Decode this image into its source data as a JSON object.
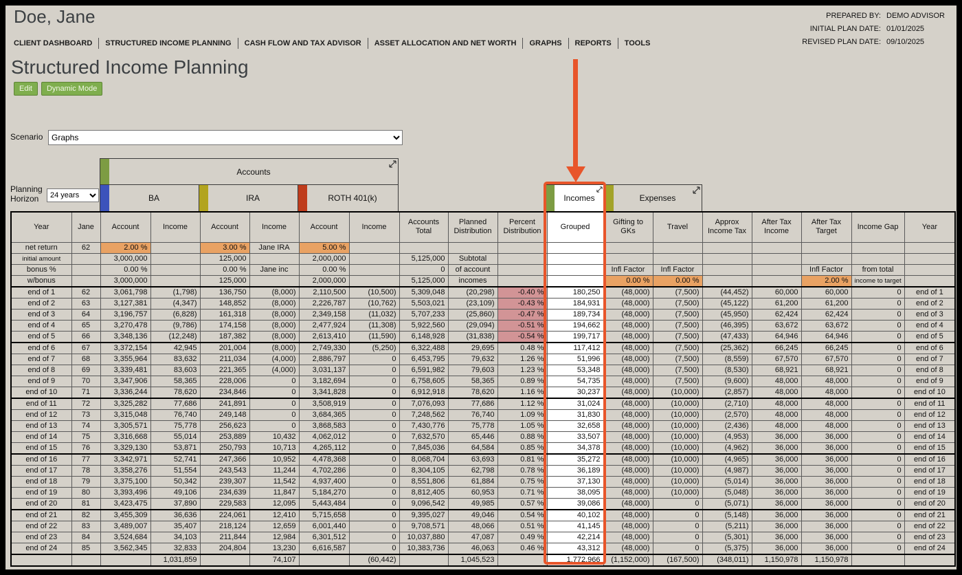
{
  "header": {
    "client_name": "Doe, Jane"
  },
  "plan_info": {
    "prepared_by_label": "PREPARED BY:",
    "prepared_by": "DEMO ADVISOR",
    "initial_plan_label": "INITIAL PLAN DATE:",
    "initial_plan_date": "01/01/2025",
    "revised_plan_label": "REVISED PLAN DATE:",
    "revised_plan_date": "09/10/2025"
  },
  "nav": {
    "items": [
      "CLIENT DASHBOARD",
      "STRUCTURED INCOME PLANNING",
      "CASH FLOW AND TAX ADVISOR",
      "ASSET ALLOCATION AND NET WORTH",
      "GRAPHS",
      "REPORTS",
      "TOOLS"
    ]
  },
  "page": {
    "title": "Structured Income Planning",
    "buttons": [
      "Edit",
      "Dynamic Mode"
    ]
  },
  "scenario": {
    "label": "Scenario",
    "value": "Graphs"
  },
  "planning_horizon": {
    "label": "Planning Horizon",
    "value": "24 years"
  },
  "groups": {
    "accounts": "Accounts",
    "ba": "BA",
    "ira": "IRA",
    "roth": "ROTH 401(k)",
    "incomes": "Incomes",
    "expenses": "Expenses"
  },
  "icons": {
    "expand": "diagonal-resize-arrows"
  },
  "colors": {
    "accent_annotation": "#e8552a",
    "rate_highlight": "#e9a263",
    "negative_pct": "#d29496",
    "button_green": "#7fae4e",
    "chip_green": "#7d9c43",
    "chip_blue": "#3c53bb",
    "chip_yellow": "#b2a41f",
    "chip_red": "#bf3c1c",
    "chip_olive": "#a3a329",
    "background": "#d5d1c9"
  },
  "table": {
    "columns": [
      "Year",
      "Jane",
      "Account",
      "Income",
      "Account",
      "Income",
      "Account",
      "Income",
      "Accounts Total",
      "Planned Distribution",
      "Percent Distribution",
      "Grouped",
      "Gifting to GKs",
      "Travel",
      "Approx Income Tax",
      "After Tax Income",
      "After Tax Target",
      "Income Gap",
      "Year"
    ],
    "pre_rows": [
      [
        "net return",
        "62",
        {
          "t": "2.00 %",
          "hl": true
        },
        "",
        {
          "t": "3.00 %",
          "hl": true
        },
        "Jane IRA",
        {
          "t": "5.00 %",
          "hl": true
        },
        "",
        "",
        "",
        "",
        "",
        "",
        "",
        "",
        "",
        "",
        "",
        ""
      ],
      [
        "initial amount",
        "",
        "3,000,000",
        "",
        "125,000",
        "",
        "2,000,000",
        "",
        "5,125,000",
        "Subtotal",
        "",
        "",
        "",
        "",
        "",
        "",
        "",
        "",
        ""
      ],
      [
        "bonus %",
        "",
        "0.00 %",
        "",
        "0.00 %",
        "Jane inc",
        "0.00 %",
        "",
        "0",
        "of account",
        "",
        "",
        "Infl Factor",
        "Infl Factor",
        "",
        "",
        "Infl Factor",
        "from total",
        ""
      ],
      [
        "w/bonus",
        "",
        "3,000,000",
        "",
        "125,000",
        "",
        "2,000,000",
        "",
        "5,125,000",
        "incomes",
        "",
        "",
        {
          "t": "0.00 %",
          "hl": true
        },
        {
          "t": "0.00 %",
          "hl": true
        },
        "",
        "",
        {
          "t": "2.00 %",
          "hl": true
        },
        "income to target",
        ""
      ]
    ],
    "rows": [
      [
        "end of 1",
        "62",
        "3,061,798",
        "(1,798)",
        "136,750",
        "(8,000)",
        "2,110,500",
        "(10,500)",
        "5,309,048",
        "(20,298)",
        "-0.40 %",
        "180,250",
        "(48,000)",
        "(7,500)",
        "(44,452)",
        "60,000",
        "60,000",
        "0",
        "end of 1"
      ],
      [
        "end of 2",
        "63",
        "3,127,381",
        "(4,347)",
        "148,852",
        "(8,000)",
        "2,226,787",
        "(10,762)",
        "5,503,021",
        "(23,109)",
        "-0.43 %",
        "184,931",
        "(48,000)",
        "(7,500)",
        "(45,122)",
        "61,200",
        "61,200",
        "0",
        "end of 2"
      ],
      [
        "end of 3",
        "64",
        "3,196,757",
        "(6,828)",
        "161,318",
        "(8,000)",
        "2,349,158",
        "(11,032)",
        "5,707,233",
        "(25,860)",
        "-0.47 %",
        "189,734",
        "(48,000)",
        "(7,500)",
        "(45,950)",
        "62,424",
        "62,424",
        "0",
        "end of 3"
      ],
      [
        "end of 4",
        "65",
        "3,270,478",
        "(9,786)",
        "174,158",
        "(8,000)",
        "2,477,924",
        "(11,308)",
        "5,922,560",
        "(29,094)",
        "-0.51 %",
        "194,662",
        "(48,000)",
        "(7,500)",
        "(46,395)",
        "63,672",
        "63,672",
        "0",
        "end of 4"
      ],
      [
        "end of 5",
        "66",
        "3,348,136",
        "(12,248)",
        "187,382",
        "(8,000)",
        "2,613,410",
        "(11,590)",
        "6,148,928",
        "(31,838)",
        "-0.54 %",
        "199,717",
        "(48,000)",
        "(7,500)",
        "(47,433)",
        "64,946",
        "64,946",
        "0",
        "end of 5"
      ],
      [
        "end of 6",
        "67",
        "3,372,154",
        "42,945",
        "201,004",
        "(8,000)",
        "2,749,330",
        "(5,250)",
        "6,322,488",
        "29,695",
        "0.48 %",
        "117,412",
        "(48,000)",
        "(7,500)",
        "(25,362)",
        "66,245",
        "66,245",
        "0",
        "end of 6"
      ],
      [
        "end of 7",
        "68",
        "3,355,964",
        "83,632",
        "211,034",
        "(4,000)",
        "2,886,797",
        "0",
        "6,453,795",
        "79,632",
        "1.26 %",
        "51,996",
        "(48,000)",
        "(7,500)",
        "(8,559)",
        "67,570",
        "67,570",
        "0",
        "end of 7"
      ],
      [
        "end of 8",
        "69",
        "3,339,481",
        "83,603",
        "221,365",
        "(4,000)",
        "3,031,137",
        "0",
        "6,591,982",
        "79,603",
        "1.23 %",
        "53,348",
        "(48,000)",
        "(7,500)",
        "(8,530)",
        "68,921",
        "68,921",
        "0",
        "end of 8"
      ],
      [
        "end of 9",
        "70",
        "3,347,906",
        "58,365",
        "228,006",
        "0",
        "3,182,694",
        "0",
        "6,758,605",
        "58,365",
        "0.89 %",
        "54,735",
        "(48,000)",
        "(7,500)",
        "(9,600)",
        "48,000",
        "48,000",
        "0",
        "end of 9"
      ],
      [
        "end of 10",
        "71",
        "3,336,244",
        "78,620",
        "234,846",
        "0",
        "3,341,828",
        "0",
        "6,912,918",
        "78,620",
        "1.16 %",
        "30,237",
        "(48,000)",
        "(10,000)",
        "(2,857)",
        "48,000",
        "48,000",
        "0",
        "end of 10"
      ],
      [
        "end of 11",
        "72",
        "3,325,282",
        "77,686",
        "241,891",
        "0",
        "3,508,919",
        "0",
        "7,076,093",
        "77,686",
        "1.12 %",
        "31,024",
        "(48,000)",
        "(10,000)",
        "(2,710)",
        "48,000",
        "48,000",
        "0",
        "end of 11"
      ],
      [
        "end of 12",
        "73",
        "3,315,048",
        "76,740",
        "249,148",
        "0",
        "3,684,365",
        "0",
        "7,248,562",
        "76,740",
        "1.09 %",
        "31,830",
        "(48,000)",
        "(10,000)",
        "(2,570)",
        "48,000",
        "48,000",
        "0",
        "end of 12"
      ],
      [
        "end of 13",
        "74",
        "3,305,571",
        "75,778",
        "256,623",
        "0",
        "3,868,583",
        "0",
        "7,430,776",
        "75,778",
        "1.05 %",
        "32,658",
        "(48,000)",
        "(10,000)",
        "(2,436)",
        "48,000",
        "48,000",
        "0",
        "end of 13"
      ],
      [
        "end of 14",
        "75",
        "3,316,668",
        "55,014",
        "253,889",
        "10,432",
        "4,062,012",
        "0",
        "7,632,570",
        "65,446",
        "0.88 %",
        "33,507",
        "(48,000)",
        "(10,000)",
        "(4,953)",
        "36,000",
        "36,000",
        "0",
        "end of 14"
      ],
      [
        "end of 15",
        "76",
        "3,329,130",
        "53,871",
        "250,793",
        "10,713",
        "4,265,112",
        "0",
        "7,845,036",
        "64,584",
        "0.85 %",
        "34,378",
        "(48,000)",
        "(10,000)",
        "(4,962)",
        "36,000",
        "36,000",
        "0",
        "end of 15"
      ],
      [
        "end of 16",
        "77",
        "3,342,971",
        "52,741",
        "247,366",
        "10,952",
        "4,478,368",
        "0",
        "8,068,704",
        "63,693",
        "0.81 %",
        "35,272",
        "(48,000)",
        "(10,000)",
        "(4,965)",
        "36,000",
        "36,000",
        "0",
        "end of 16"
      ],
      [
        "end of 17",
        "78",
        "3,358,276",
        "51,554",
        "243,543",
        "11,244",
        "4,702,286",
        "0",
        "8,304,105",
        "62,798",
        "0.78 %",
        "36,189",
        "(48,000)",
        "(10,000)",
        "(4,987)",
        "36,000",
        "36,000",
        "0",
        "end of 17"
      ],
      [
        "end of 18",
        "79",
        "3,375,100",
        "50,342",
        "239,307",
        "11,542",
        "4,937,400",
        "0",
        "8,551,806",
        "61,884",
        "0.75 %",
        "37,130",
        "(48,000)",
        "(10,000)",
        "(5,014)",
        "36,000",
        "36,000",
        "0",
        "end of 18"
      ],
      [
        "end of 19",
        "80",
        "3,393,496",
        "49,106",
        "234,639",
        "11,847",
        "5,184,270",
        "0",
        "8,812,405",
        "60,953",
        "0.71 %",
        "38,095",
        "(48,000)",
        "(10,000)",
        "(5,048)",
        "36,000",
        "36,000",
        "0",
        "end of 19"
      ],
      [
        "end of 20",
        "81",
        "3,423,475",
        "37,890",
        "229,583",
        "12,095",
        "5,443,484",
        "0",
        "9,096,542",
        "49,985",
        "0.57 %",
        "39,086",
        "(48,000)",
        "0",
        "(5,071)",
        "36,000",
        "36,000",
        "0",
        "end of 20"
      ],
      [
        "end of 21",
        "82",
        "3,455,309",
        "36,636",
        "224,061",
        "12,410",
        "5,715,658",
        "0",
        "9,395,027",
        "49,046",
        "0.54 %",
        "40,102",
        "(48,000)",
        "0",
        "(5,148)",
        "36,000",
        "36,000",
        "0",
        "end of 21"
      ],
      [
        "end of 22",
        "83",
        "3,489,007",
        "35,407",
        "218,124",
        "12,659",
        "6,001,440",
        "0",
        "9,708,571",
        "48,066",
        "0.51 %",
        "41,145",
        "(48,000)",
        "0",
        "(5,211)",
        "36,000",
        "36,000",
        "0",
        "end of 22"
      ],
      [
        "end of 23",
        "84",
        "3,524,684",
        "34,103",
        "211,844",
        "12,984",
        "6,301,512",
        "0",
        "10,037,880",
        "47,087",
        "0.49 %",
        "42,214",
        "(48,000)",
        "0",
        "(5,301)",
        "36,000",
        "36,000",
        "0",
        "end of 23"
      ],
      [
        "end of 24",
        "85",
        "3,562,345",
        "32,833",
        "204,804",
        "13,230",
        "6,616,587",
        "0",
        "10,383,736",
        "46,063",
        "0.46 %",
        "43,312",
        "(48,000)",
        "0",
        "(5,375)",
        "36,000",
        "36,000",
        "0",
        "end of 24"
      ]
    ],
    "footer": [
      "",
      "",
      "",
      "1,031,859",
      "",
      "74,107",
      "",
      "(60,442)",
      "",
      "1,045,523",
      "",
      "1,772,966",
      "(1,152,000)",
      "(167,500)",
      "(348,011)",
      "1,150,978",
      "1,150,978",
      "",
      ""
    ]
  }
}
